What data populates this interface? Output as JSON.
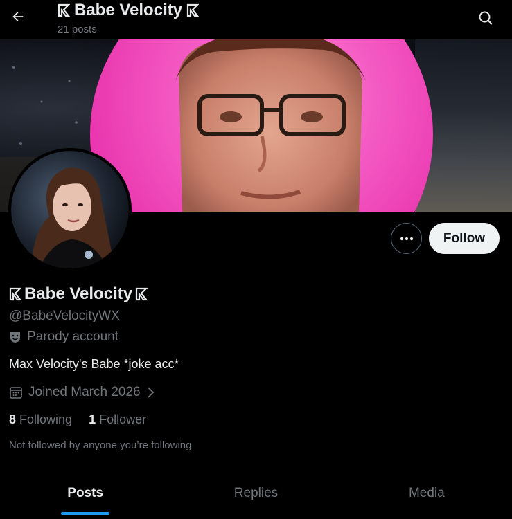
{
  "header": {
    "title": "Babe Velocity",
    "post_count": "21 posts"
  },
  "profile": {
    "display_name": "Babe Velocity",
    "handle": "@BabeVelocityWX",
    "parody_label": "Parody account",
    "bio": "Max Velocity's Babe *joke acc*",
    "joined": "Joined March 2026",
    "following_count": "8",
    "following_label": "Following",
    "followers_count": "1",
    "followers_label": "Follower",
    "not_followed_text": "Not followed by anyone you’re following"
  },
  "actions": {
    "follow_label": "Follow",
    "more_icon": "ellipsis-icon"
  },
  "tabs": [
    {
      "label": "Posts",
      "active": true
    },
    {
      "label": "Replies",
      "active": false
    },
    {
      "label": "Media",
      "active": false
    }
  ],
  "colors": {
    "accent": "#1d9bf0",
    "background": "#000000",
    "muted_text": "#71767b",
    "primary_text": "#e7e9ea"
  }
}
